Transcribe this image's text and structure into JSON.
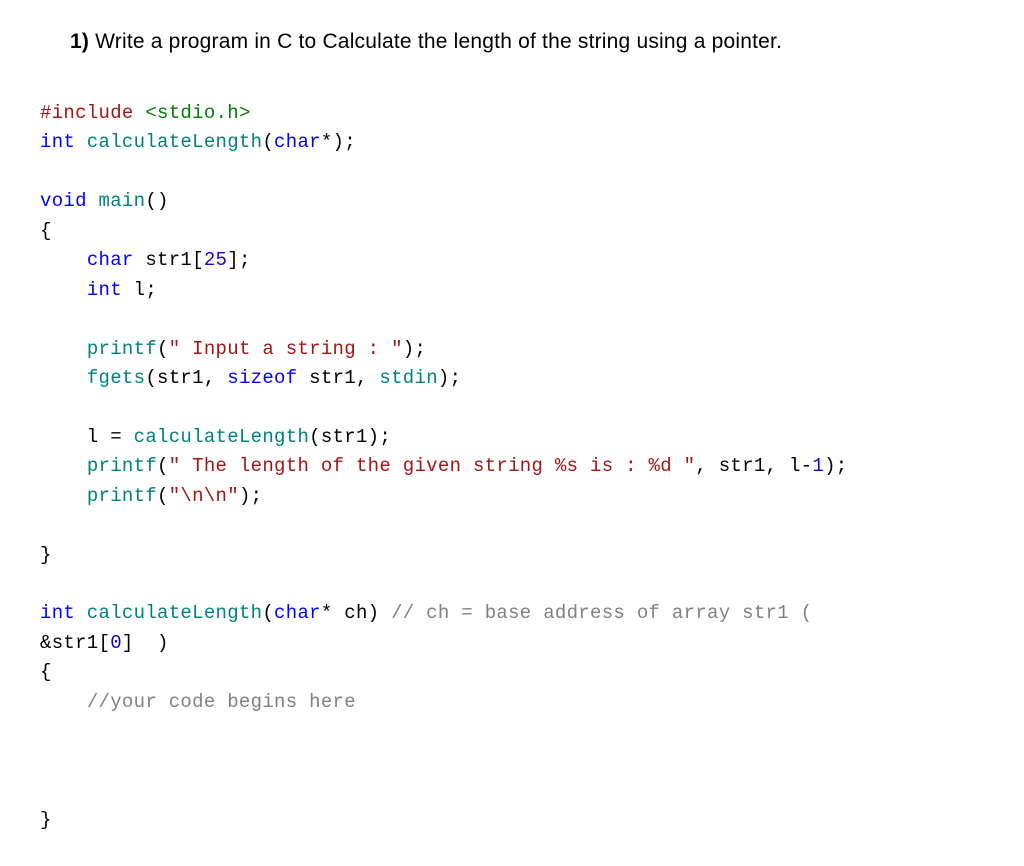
{
  "question": {
    "number": "1)",
    "text": "Write a program in C to Calculate the length of the string using a pointer."
  },
  "code": {
    "preproc": "#include",
    "header": " <stdio.h>",
    "line2_a": "int",
    "line2_b": " calculateLength",
    "line2_c": "(",
    "line2_d": "char",
    "line2_e": "*);",
    "void": "void",
    "main": " main",
    "main_paren": "()",
    "brace_open": "{",
    "char": "char",
    "str1_decl": " str1",
    "str1_bracket_open": "[",
    "str1_size": "25",
    "str1_bracket_close": "];",
    "int_l_kw": "int",
    "int_l_var": " l;",
    "printf1": "printf",
    "printf1_open": "(",
    "printf1_str": "\" Input a string : \"",
    "printf1_close": ");",
    "fgets": "fgets",
    "fgets_open": "(str1, ",
    "sizeof": "sizeof",
    "fgets_mid": " str1, ",
    "stdin": "stdin",
    "fgets_close": ");",
    "l_assign": "    l = ",
    "calc_call": "calculateLength",
    "calc_call_args": "(str1);",
    "printf2": "printf",
    "printf2_open": "(",
    "printf2_str": "\" The length of the given string %s is : %d \"",
    "printf2_mid": ", str1, l-",
    "printf2_one": "1",
    "printf2_close": ");",
    "printf3": "printf",
    "printf3_open": "(",
    "printf3_str": "\"\\n\\n\"",
    "printf3_close": ");",
    "brace_close": "}",
    "func_def_int": "int",
    "func_def_name": " calculateLength",
    "func_def_open": "(",
    "func_def_char": "char",
    "func_def_star": "* ch) ",
    "func_def_comment1": "// ch = base address of array str1 ( ",
    "func_def_line2a": "&str1[",
    "func_def_zero": "0",
    "func_def_line2b": "]  )",
    "brace_open2": "{",
    "comment_begin": "//your code begins here",
    "brace_close2": "}"
  }
}
